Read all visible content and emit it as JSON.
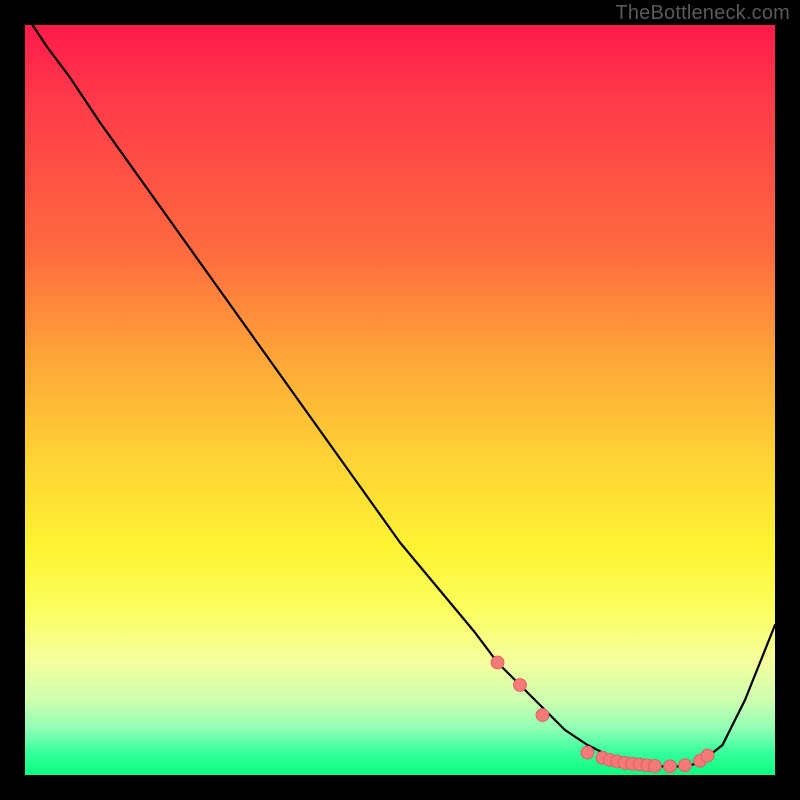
{
  "watermark": "TheBottleneck.com",
  "colors": {
    "line": "#000000",
    "dot_fill": "#f47a7a",
    "dot_stroke": "#d85a5a",
    "gradient_top": "#ff1a4a",
    "gradient_mid": "#fff433",
    "gradient_bottom": "#0bff7f",
    "frame": "#000000"
  },
  "chart_data": {
    "type": "line",
    "title": "",
    "xlabel": "",
    "ylabel": "",
    "xlim": [
      0,
      100
    ],
    "ylim": [
      0,
      100
    ],
    "note": "Axis tick labels are not shown in the image; values are estimated from pixel position on a 0–100 normalized scale. Y approximates a bottleneck percentage (high=red/bad, low=green/good).",
    "x": [
      1,
      3,
      6,
      10,
      15,
      20,
      25,
      30,
      35,
      40,
      45,
      50,
      55,
      60,
      63,
      66,
      69,
      72,
      75,
      78,
      80,
      82,
      84,
      86,
      88,
      90,
      93,
      96,
      100
    ],
    "y": [
      100,
      97,
      93,
      87,
      80,
      73,
      66,
      59,
      52,
      45,
      38,
      31,
      25,
      19,
      15,
      12,
      9,
      6,
      4,
      2.5,
      1.8,
      1.4,
      1.2,
      1.1,
      1.2,
      1.6,
      4,
      10,
      20
    ],
    "series": [
      {
        "name": "bottleneck-curve",
        "use_shared_xy": true
      }
    ],
    "markers": {
      "name": "highlighted-points",
      "x": [
        63,
        66,
        69,
        75,
        77,
        78,
        79,
        80,
        81,
        82,
        83,
        84,
        86,
        88,
        90,
        91
      ],
      "y": [
        15,
        12,
        8,
        3,
        2.3,
        2.0,
        1.8,
        1.6,
        1.5,
        1.4,
        1.3,
        1.2,
        1.15,
        1.3,
        1.9,
        2.6
      ]
    }
  }
}
